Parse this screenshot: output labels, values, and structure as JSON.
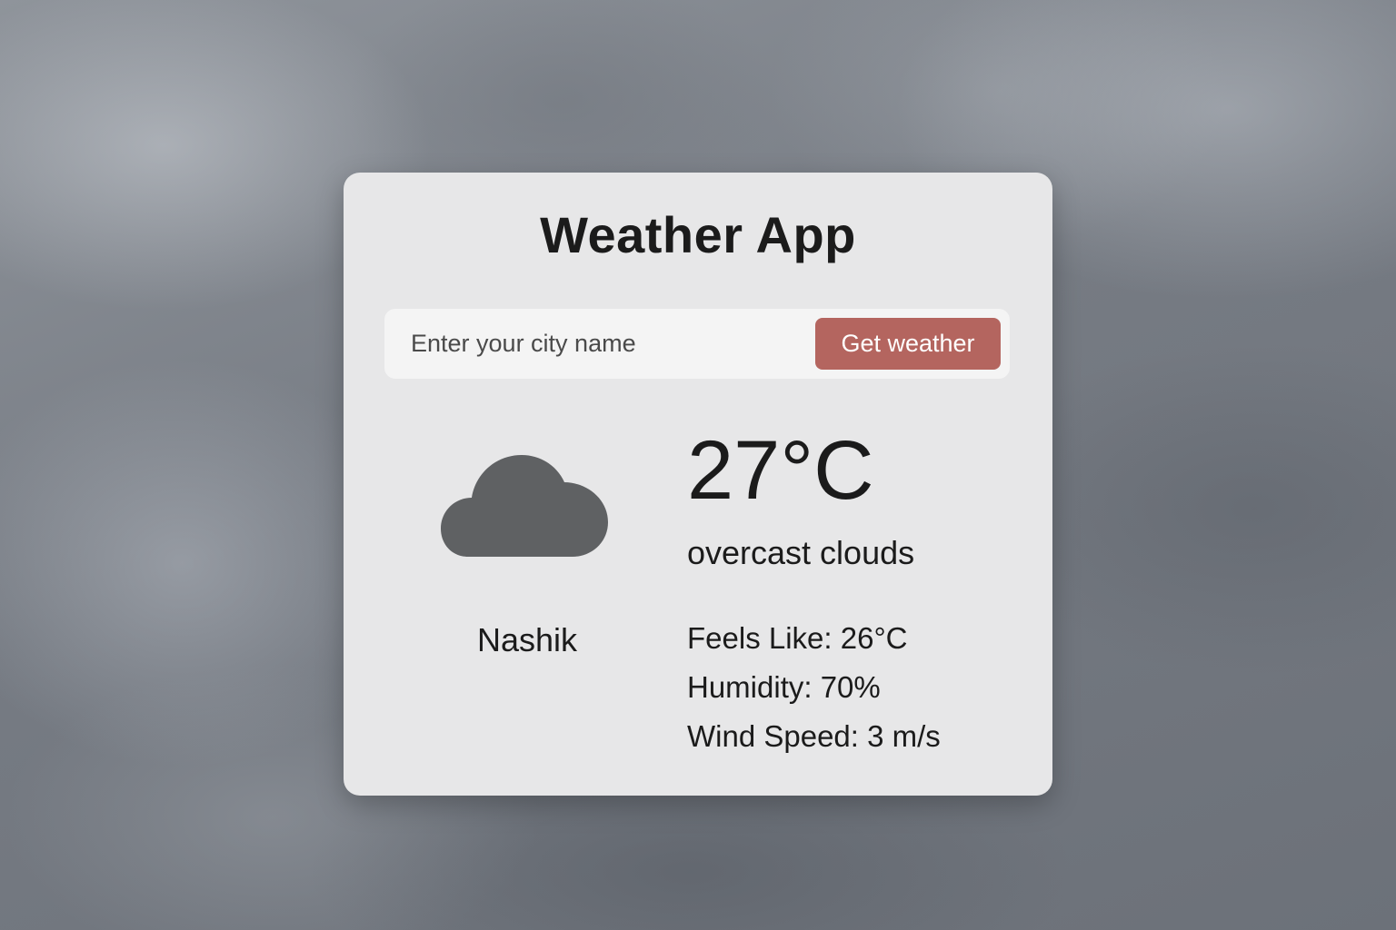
{
  "app": {
    "title": "Weather App"
  },
  "search": {
    "placeholder": "Enter your city name",
    "value": "",
    "button_label": "Get weather"
  },
  "weather": {
    "icon": "cloud-icon",
    "city": "Nashik",
    "temperature": "27°C",
    "description": "overcast clouds",
    "feels_like": "Feels Like: 26°C",
    "humidity": "Humidity: 70%",
    "wind_speed": "Wind Speed: 3 m/s"
  },
  "colors": {
    "button": "#b4655f",
    "icon": "#5f6163",
    "card": "#e7e7e8"
  }
}
